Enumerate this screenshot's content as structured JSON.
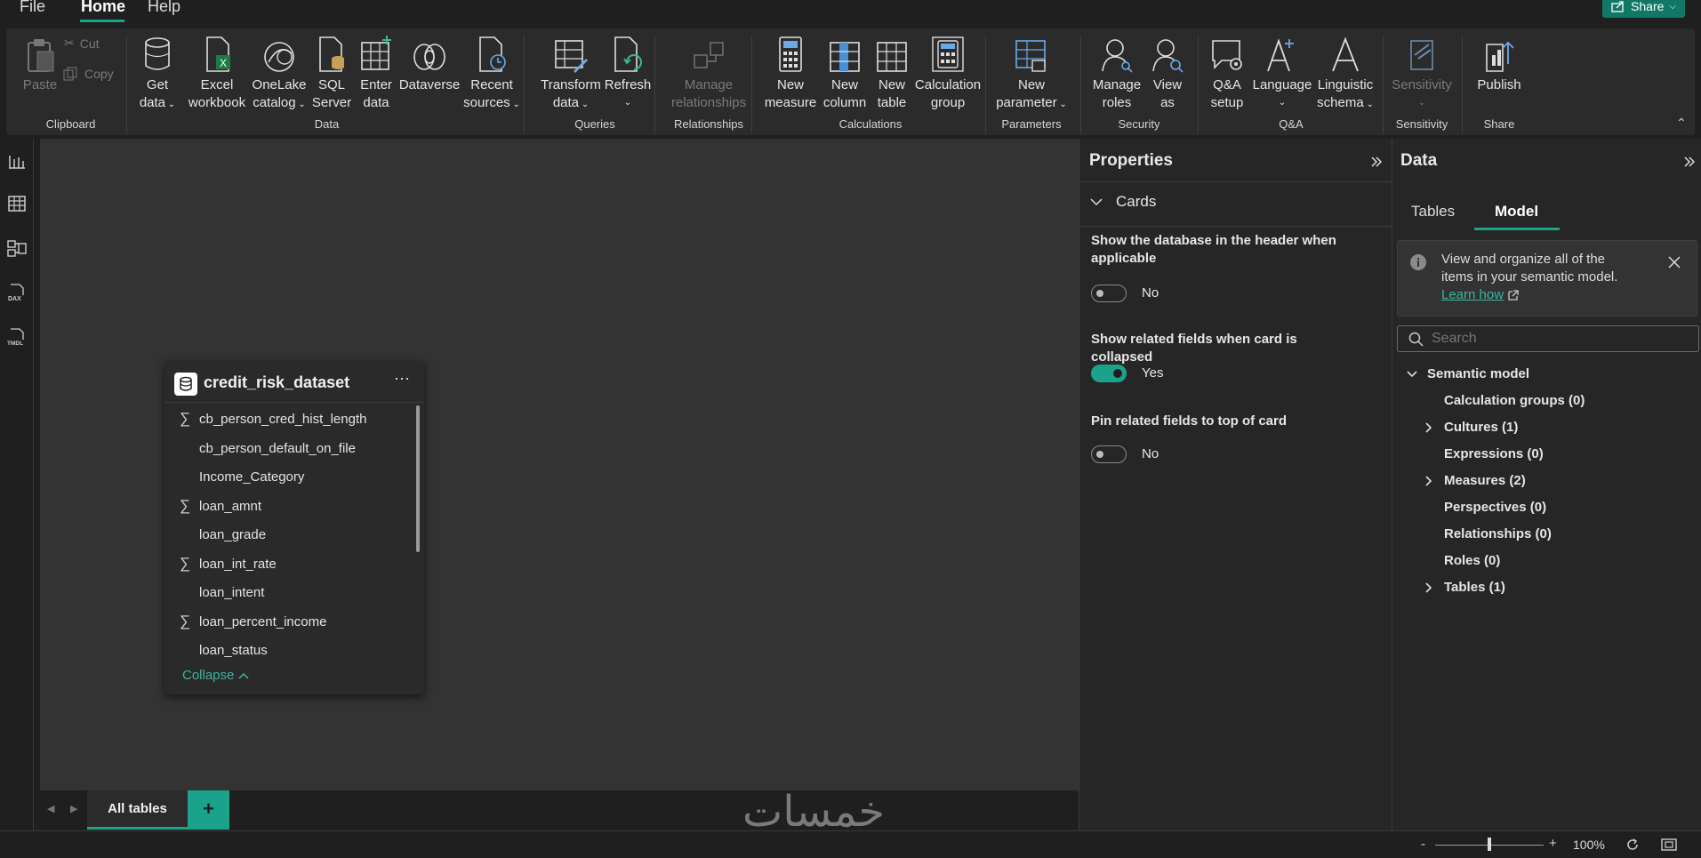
{
  "menu": {
    "file": "File",
    "home": "Home",
    "help": "Help",
    "share": "Share"
  },
  "ribbon": {
    "clipboard": {
      "paste": "Paste",
      "cut": "Cut",
      "copy": "Copy",
      "group": "Clipboard"
    },
    "data": {
      "get_data": [
        "Get",
        "data"
      ],
      "excel": [
        "Excel",
        "workbook"
      ],
      "onelake": [
        "OneLake",
        "catalog"
      ],
      "sql": [
        "SQL",
        "Server"
      ],
      "enter": [
        "Enter",
        "data"
      ],
      "dataverse": "Dataverse",
      "recent": [
        "Recent",
        "sources"
      ],
      "group": "Data"
    },
    "queries": {
      "transform": [
        "Transform",
        "data"
      ],
      "refresh": "Refresh",
      "group": "Queries"
    },
    "relationships": {
      "manage": [
        "Manage",
        "relationships"
      ],
      "group": "Relationships"
    },
    "calculations": {
      "new_measure": [
        "New",
        "measure"
      ],
      "new_column": [
        "New",
        "column"
      ],
      "new_table": [
        "New",
        "table"
      ],
      "calc_group": [
        "Calculation",
        "group"
      ],
      "group": "Calculations"
    },
    "parameters": {
      "new_param": [
        "New",
        "parameter"
      ],
      "group": "Parameters"
    },
    "security": {
      "manage_roles": [
        "Manage",
        "roles"
      ],
      "view_as": [
        "View",
        "as"
      ],
      "group": "Security"
    },
    "qa": {
      "qa_setup": [
        "Q&A",
        "setup"
      ],
      "language": "Language",
      "linguistic": [
        "Linguistic",
        "schema"
      ],
      "group": "Q&A"
    },
    "sensitivity": {
      "label": "Sensitivity",
      "group": "Sensitivity"
    },
    "share": {
      "publish": "Publish",
      "group": "Share"
    }
  },
  "card": {
    "title": "credit_risk_dataset",
    "fields": [
      {
        "name": "cb_person_cred_hist_length",
        "sigma": "∑"
      },
      {
        "name": "cb_person_default_on_file",
        "sigma": ""
      },
      {
        "name": "Income_Category",
        "sigma": ""
      },
      {
        "name": "loan_amnt",
        "sigma": "∑"
      },
      {
        "name": "loan_grade",
        "sigma": ""
      },
      {
        "name": "loan_int_rate",
        "sigma": "∑"
      },
      {
        "name": "loan_intent",
        "sigma": ""
      },
      {
        "name": "loan_percent_income",
        "sigma": "∑"
      },
      {
        "name": "loan_status",
        "sigma": ""
      }
    ],
    "collapse": "Collapse"
  },
  "tabs": {
    "all_tables": "All tables",
    "add": "+"
  },
  "watermark": "خمسات",
  "properties": {
    "title": "Properties",
    "section": "Cards",
    "opt1_label": "Show the database in the header when applicable",
    "opt1_value": "No",
    "opt2_label": "Show related fields when card is collapsed",
    "opt2_value": "Yes",
    "opt3_label": "Pin related fields to top of card",
    "opt3_value": "No"
  },
  "datapane": {
    "title": "Data",
    "tab_tables": "Tables",
    "tab_model": "Model",
    "info_text": "View and organize all of the items in your semantic model.",
    "info_link": "Learn how",
    "search_placeholder": "Search",
    "root": "Semantic model",
    "items": [
      {
        "label": "Calculation groups (0)",
        "expandable": false
      },
      {
        "label": "Cultures (1)",
        "expandable": true
      },
      {
        "label": "Expressions (0)",
        "expandable": false
      },
      {
        "label": "Measures (2)",
        "expandable": true
      },
      {
        "label": "Perspectives (0)",
        "expandable": false
      },
      {
        "label": "Relationships (0)",
        "expandable": false
      },
      {
        "label": "Roles (0)",
        "expandable": false
      },
      {
        "label": "Tables (1)",
        "expandable": true
      }
    ]
  },
  "status": {
    "zoom": "100%",
    "minus": "-",
    "plus": "+",
    "zoom_level": 0.5
  },
  "colors": {
    "accent": "#1aa38a",
    "share_bg": "#117865",
    "canvas": "#333333"
  }
}
